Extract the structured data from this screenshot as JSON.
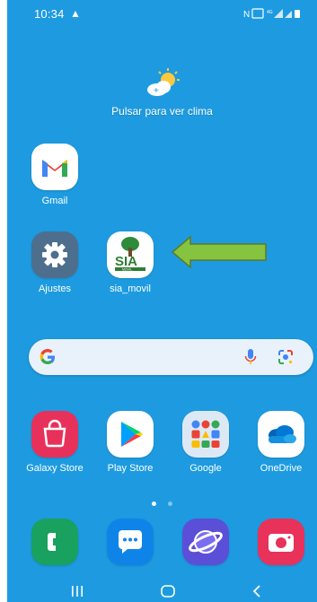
{
  "status_bar": {
    "time": "10:34",
    "alert_icon": "warning-icon",
    "right_icons": "mute, VoLTE, signal, wifi, battery"
  },
  "weather_widget": {
    "label": "Pulsar para ver clima",
    "icon": "sun-cloud-icon"
  },
  "home_apps": {
    "gmail": "Gmail",
    "ajustes": "Ajustes",
    "sia_movil": "sia_movil"
  },
  "annotation": {
    "arrow_color": "#86c440",
    "arrow_border": "#5a7a28"
  },
  "search_bar": {
    "logo": "google-g-icon",
    "mic": "mic-icon",
    "lens": "lens-icon"
  },
  "app_row": {
    "galaxy_store": "Galaxy Store",
    "play_store": "Play Store",
    "google": "Google",
    "onedrive": "OneDrive"
  },
  "page_indicator": {
    "pages": 2,
    "active": 1
  },
  "dock": [
    "phone-icon",
    "messages-icon",
    "internet-icon",
    "camera-icon"
  ],
  "nav": [
    "recents-button",
    "home-button",
    "back-button"
  ],
  "colors": {
    "wallpaper": "#1e9be0",
    "text": "#ffffff"
  }
}
